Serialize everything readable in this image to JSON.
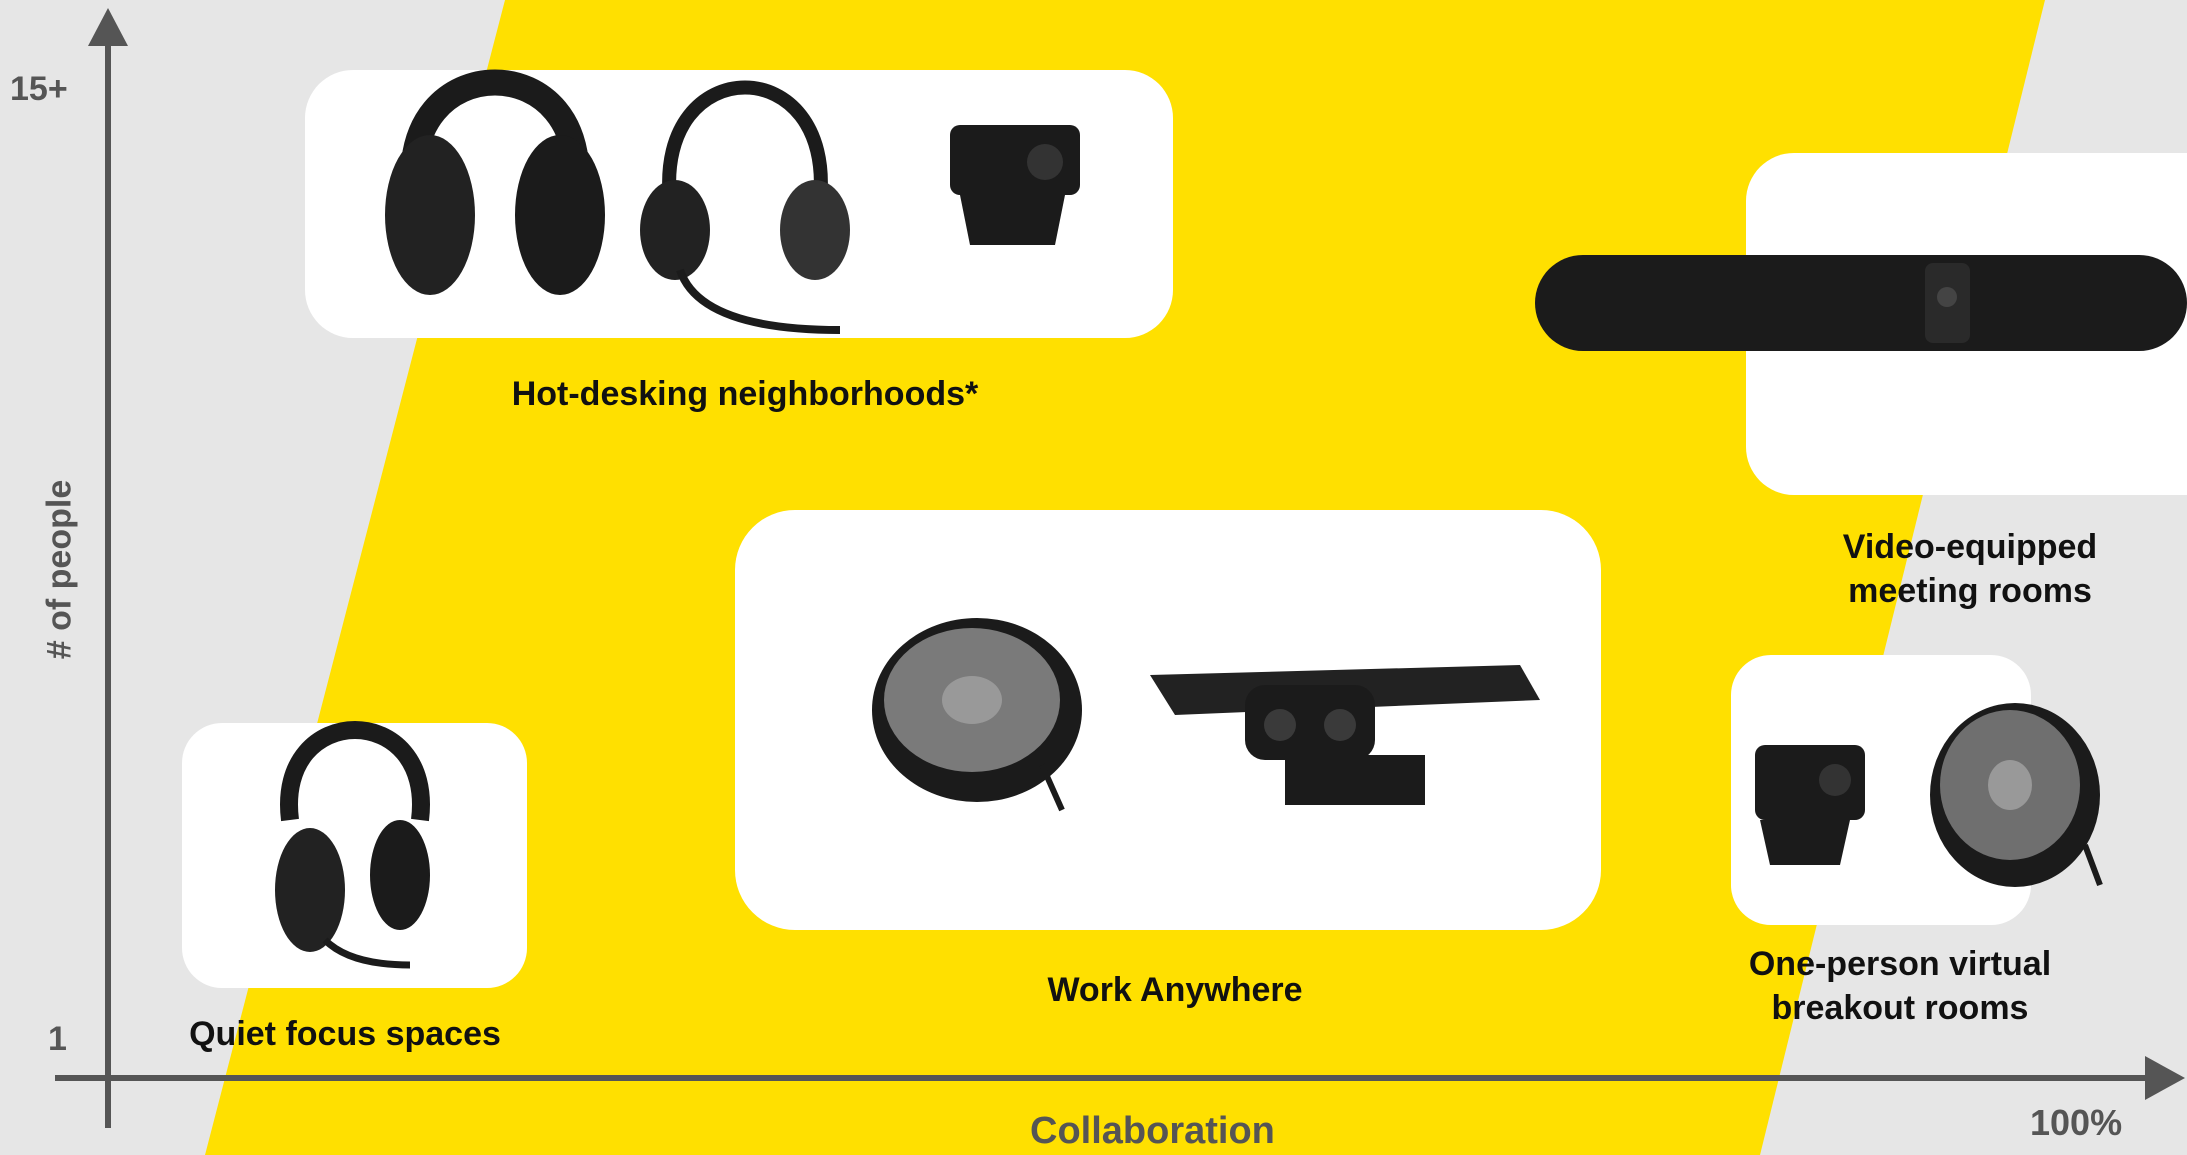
{
  "colors": {
    "background": "#e6e6e6",
    "accent": "#ffe000",
    "axis": "#555555",
    "card": "#ffffff",
    "device": "#1b1b1b"
  },
  "axis": {
    "y_label": "# of people",
    "y_top": "15+",
    "y_bottom": "1",
    "x_label": "Collaboration",
    "x_right": "100%"
  },
  "zones": {
    "hot_desking": {
      "label": "Hot-desking neighborhoods*",
      "devices": [
        "over-ear-headset-icon",
        "on-ear-headset-icon",
        "personal-webcam-icon"
      ]
    },
    "meeting_rooms": {
      "label_line1": "Video-equipped",
      "label_line2": "meeting rooms",
      "devices": [
        "video-bar-icon"
      ]
    },
    "work_anywhere": {
      "label": "Work Anywhere",
      "devices": [
        "speakerphone-icon",
        "panoramic-camera-icon"
      ]
    },
    "breakout_rooms": {
      "label_line1": "One-person virtual",
      "label_line2": "breakout rooms",
      "devices": [
        "personal-webcam-icon",
        "speakerphone-icon"
      ]
    },
    "quiet_focus": {
      "label": "Quiet focus spaces",
      "devices": [
        "over-ear-headset-icon"
      ]
    }
  }
}
